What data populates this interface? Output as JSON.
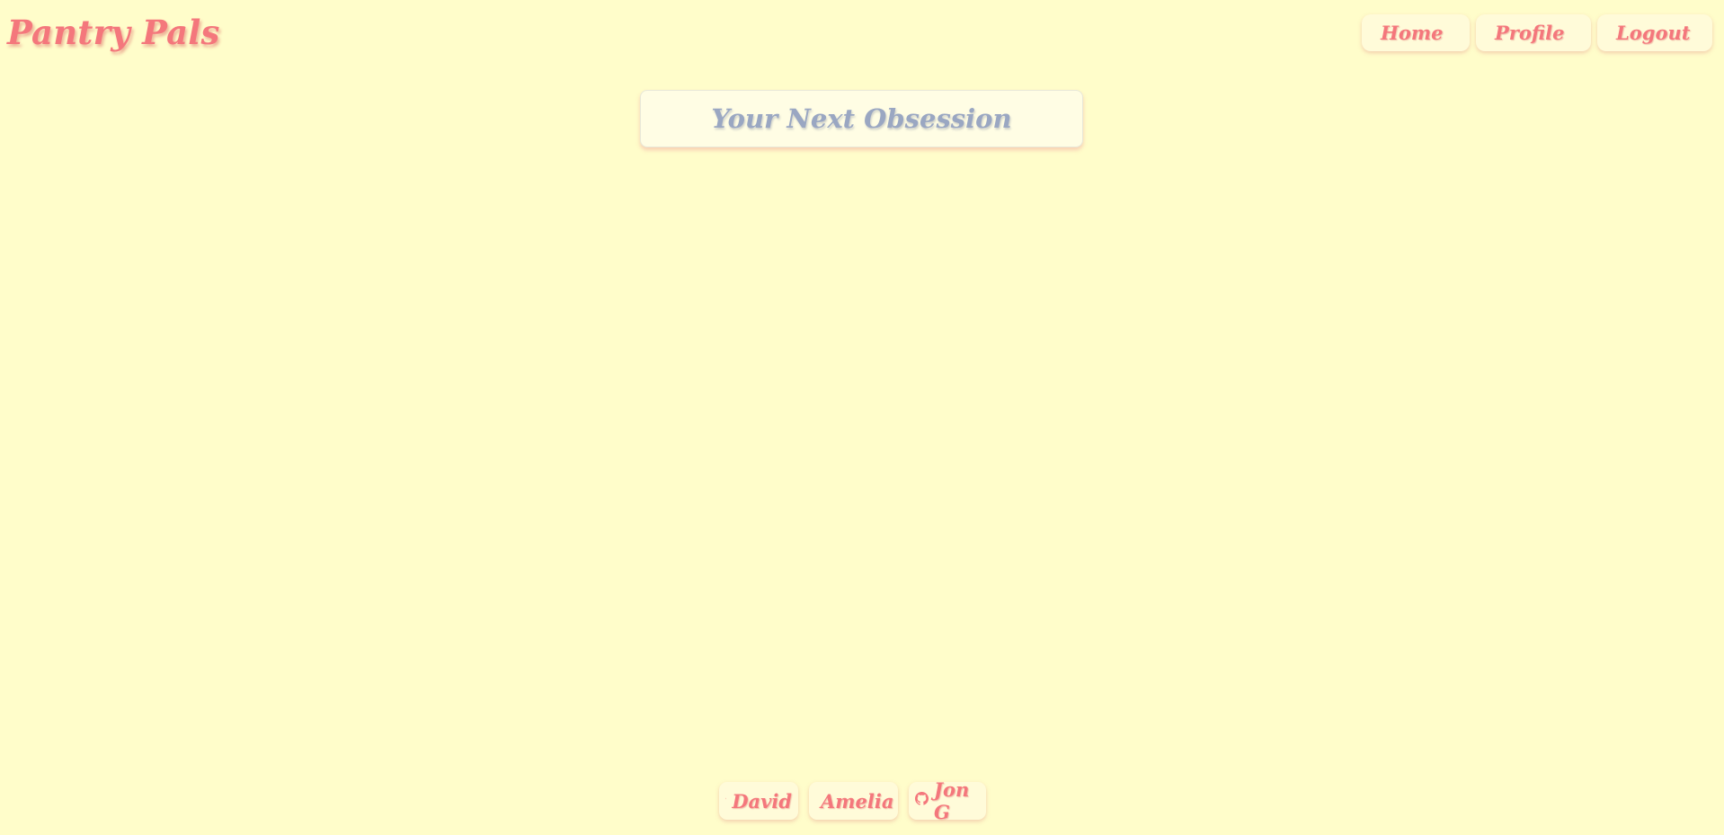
{
  "brand": {
    "name": "Pantry Pals"
  },
  "nav": {
    "items": [
      {
        "label": "Home",
        "icon": "utensils-icon"
      },
      {
        "label": "Profile",
        "icon": "utensils-icon"
      },
      {
        "label": "Logout",
        "icon": "utensils-icon"
      }
    ]
  },
  "main": {
    "title": "Your Next Obsession"
  },
  "footer": {
    "credits": [
      {
        "label": "David",
        "icon": "github-icon"
      },
      {
        "label": "Amelia",
        "icon": "github-icon"
      },
      {
        "label": "Jon G",
        "icon": "github-icon"
      }
    ]
  },
  "colors": {
    "background": "#fffdca",
    "accent": "#f4777c",
    "title": "#9aa7c2",
    "card": "#fffbd9"
  }
}
